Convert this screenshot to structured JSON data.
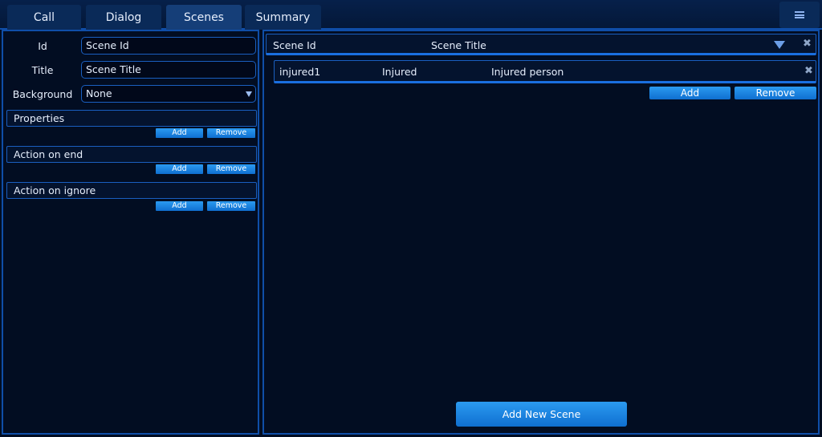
{
  "tabs": [
    {
      "label": "Call"
    },
    {
      "label": "Dialog"
    },
    {
      "label": "Scenes"
    },
    {
      "label": "Summary"
    }
  ],
  "active_tab": "Scenes",
  "form": {
    "id_label": "Id",
    "id_value": "Scene Id",
    "title_label": "Title",
    "title_value": "Scene Title",
    "background_label": "Background",
    "background_value": "None"
  },
  "sections": [
    {
      "title": "Properties",
      "add_label": "Add",
      "remove_label": "Remove"
    },
    {
      "title": "Action on end",
      "add_label": "Add",
      "remove_label": "Remove"
    },
    {
      "title": "Action on ignore",
      "add_label": "Add",
      "remove_label": "Remove"
    }
  ],
  "scene_header": {
    "col_id": "Scene Id",
    "col_title": "Scene Title"
  },
  "rows": [
    {
      "id": "injured1",
      "title": "Injured",
      "description": "Injured person"
    }
  ],
  "row_actions": {
    "add_label": "Add",
    "remove_label": "Remove"
  },
  "add_new_scene_label": "Add New Scene",
  "icons": {
    "menu": "hamburger-icon",
    "dropdown": "chevron-down-icon",
    "close": "close-icon"
  },
  "colors": {
    "background": "#020d22",
    "accent": "#1a6fe0",
    "button": "#1f85e0"
  }
}
